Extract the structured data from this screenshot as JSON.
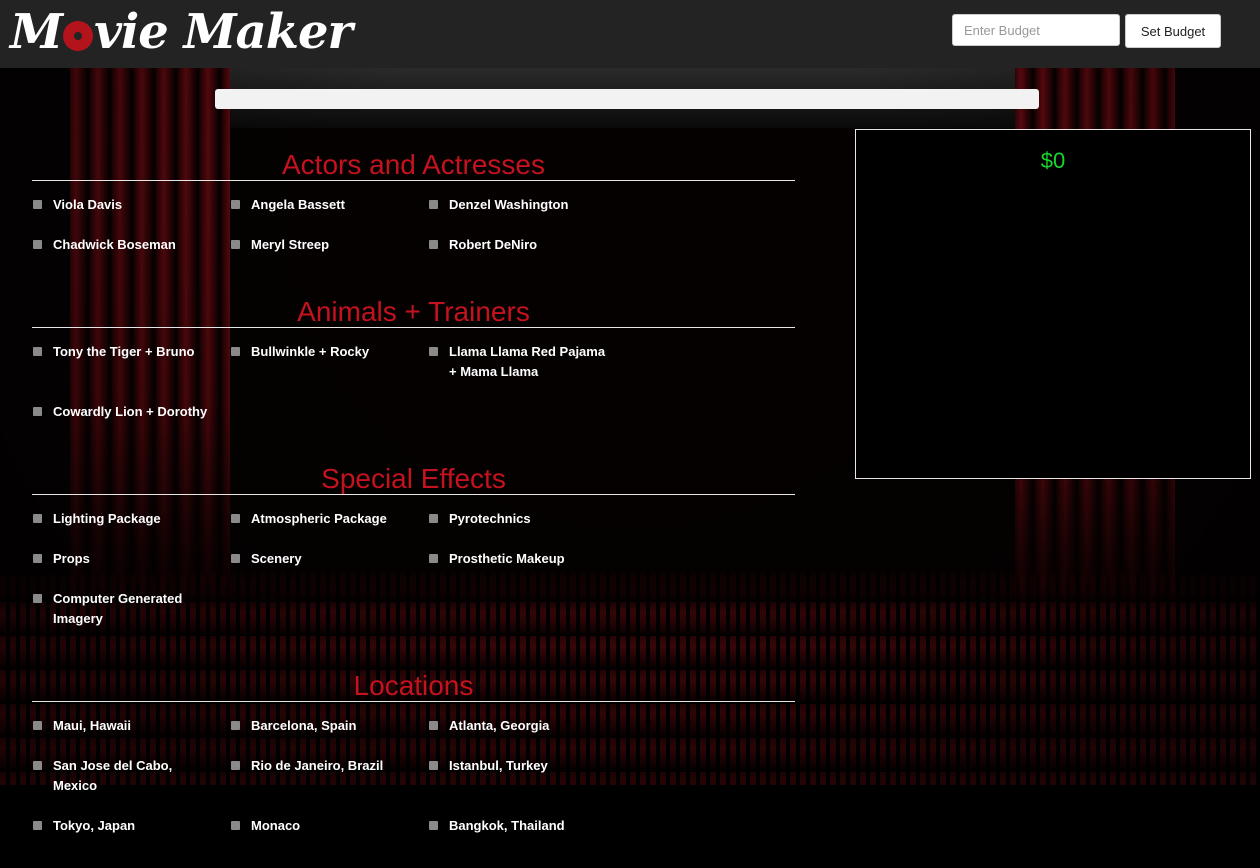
{
  "header": {
    "logo_text_1": "M",
    "logo_text_2": "vie Maker",
    "budget_placeholder": "Enter Budget",
    "budget_value": "",
    "set_budget_label": "Set Budget"
  },
  "progress": {
    "percent": 0
  },
  "sections": [
    {
      "title": "Actors and Actresses",
      "items": [
        "Viola Davis",
        "Angela Bassett",
        "Denzel Washington",
        "Chadwick Boseman",
        "Meryl Streep",
        "Robert DeNiro"
      ]
    },
    {
      "title": "Animals + Trainers",
      "items": [
        "Tony the Tiger + Bruno",
        "Bullwinkle + Rocky",
        "Llama Llama Red Pajama + Mama Llama",
        "Cowardly Lion + Dorothy"
      ]
    },
    {
      "title": "Special Effects",
      "items": [
        "Lighting Package",
        "Atmospheric Package",
        "Pyrotechnics",
        "Props",
        "Scenery",
        "Prosthetic Makeup",
        "Computer Generated Imagery"
      ]
    },
    {
      "title": "Locations",
      "items": [
        "Maui, Hawaii",
        "Barcelona, Spain",
        "Atlanta, Georgia",
        "San Jose del Cabo, Mexico",
        "Rio de Janeiro, Brazil",
        "Istanbul, Turkey",
        "Tokyo, Japan",
        "Monaco",
        "Bangkok, Thailand"
      ]
    }
  ],
  "summary": {
    "total": "$0"
  },
  "colors": {
    "accent": "#c4121e",
    "total_green": "#18d62b",
    "header_bg": "#232323"
  },
  "icons": {
    "logo_reel": "film-reel-icon",
    "checkbox": "checkbox-icon"
  }
}
